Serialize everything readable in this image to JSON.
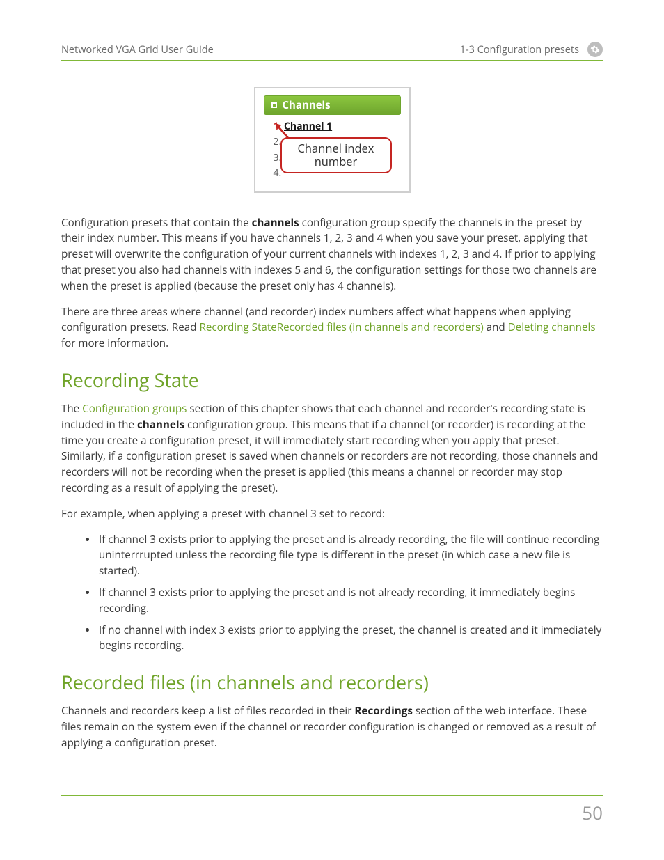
{
  "header": {
    "left": "Networked VGA Grid User Guide",
    "right": "1-3 Configuration presets"
  },
  "figure": {
    "bar_title": "Channels",
    "rows": {
      "r1_idx": "1.",
      "r1_label": "Channel 1",
      "r2_idx": "2.",
      "r3_idx": "3.",
      "r4_idx": "4."
    },
    "callout": "Channel index number"
  },
  "para1": {
    "t1": "Configuration presets that contain the ",
    "b1": "channels",
    "t2": " configuration group specify the channels in the preset by their index number. This means if you have channels 1, 2, 3 and 4 when you save your preset, applying that preset will overwrite the configuration of your current channels with indexes 1, 2, 3 and 4. If prior to applying that preset you also had channels with indexes 5 and 6, the configuration settings for those two channels are when the preset is applied (because the preset only has 4 channels)."
  },
  "para2": {
    "t1": "There are three areas where channel (and recorder) index numbers affect what happens when applying configuration presets. Read ",
    "link1": "Recording State",
    "link2": "Recorded files (in channels and recorders)",
    "t2": " and ",
    "link3": "Deleting channels",
    "t3": " for more information."
  },
  "h_recording_state": "Recording State",
  "para3": {
    "t1": "The ",
    "link1": "Configuration groups",
    "t2": " section of this chapter shows that each channel and recorder's recording state is included in the ",
    "b1": "channels",
    "t3": " configuration group. This means that if a channel (or recorder) is recording at the time you create a configuration preset, it will immediately start recording when you apply that preset. Similarly, if a configuration preset is saved when channels or recorders are not recording, those channels and recorders will not be recording when the preset is applied (this means a channel or recorder may stop recording as a result of applying the preset)."
  },
  "para4": "For example, when applying a preset with channel 3 set to record:",
  "bullets": {
    "b1": "If channel 3 exists prior to applying the preset and is already recording, the file will continue recording uninterrrupted unless the recording file type is different in the preset (in which case a new file is started).",
    "b2": "If channel 3 exists prior to applying the preset and is not already recording, it immediately begins recording.",
    "b3": "If no channel with index 3 exists prior to applying the preset, the channel is created and it immediately begins recording."
  },
  "h_recorded_files": "Recorded files (in channels and recorders)",
  "para5": {
    "t1": "Channels and recorders keep a list of files recorded in their ",
    "b1": "Recordings",
    "t2": " section of the web interface. These files remain on the system even if the channel or recorder configuration is changed or removed as a result of applying a configuration preset."
  },
  "page_number": "50"
}
